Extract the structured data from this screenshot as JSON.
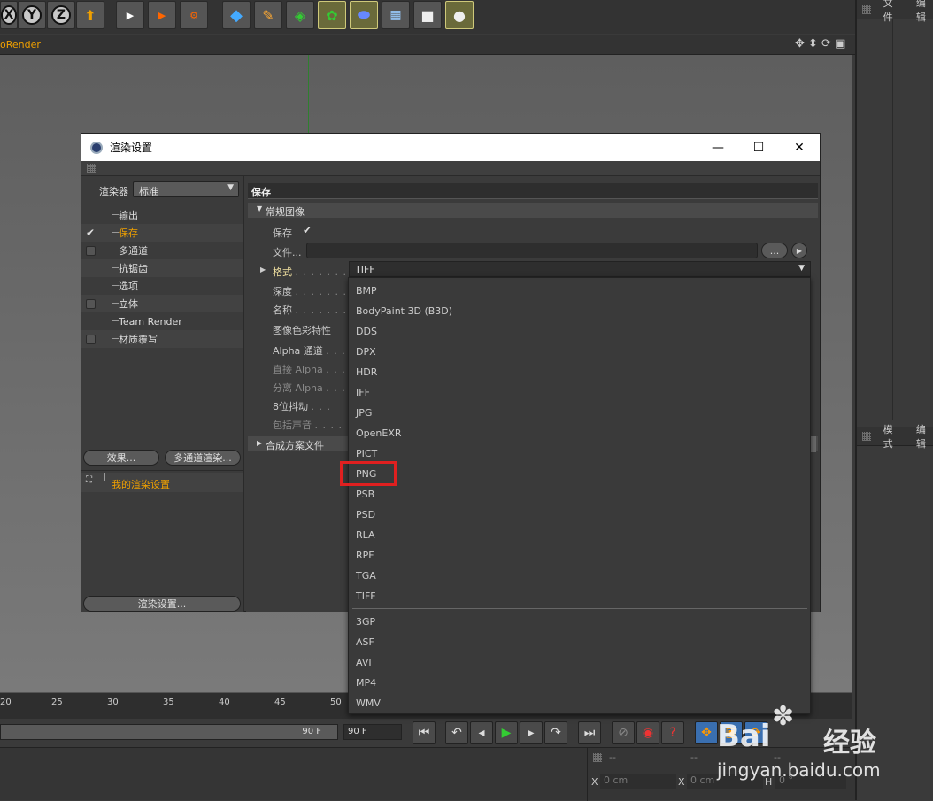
{
  "toolbar": {
    "axes": [
      "X",
      "Y",
      "Z"
    ]
  },
  "viewport": {
    "title": "oRender"
  },
  "right_panel": {
    "tabs_top": [
      "文件",
      "编辑"
    ],
    "tabs_mid": [
      "模式",
      "编辑"
    ]
  },
  "timeline": {
    "ticks": [
      "20",
      "25",
      "30",
      "35",
      "40",
      "45",
      "50"
    ],
    "end_frame": "90 F",
    "end_frame_field": "90 F"
  },
  "coords": {
    "header": [
      "--",
      "--",
      "--"
    ],
    "rows": [
      {
        "l1": "X",
        "v1": "0 cm",
        "l2": "X",
        "v2": "0 cm",
        "l3": "H",
        "v3": "0 °"
      }
    ]
  },
  "dialog": {
    "title": "渲染设置",
    "renderer_label": "渲染器",
    "renderer_value": "标准",
    "nav": [
      {
        "label": "输出",
        "checkbox": false,
        "selected": false
      },
      {
        "label": "保存",
        "checkbox": true,
        "checked": true,
        "selected": true
      },
      {
        "label": "多通道",
        "checkbox": true,
        "checked": false,
        "selected": false
      },
      {
        "label": "抗锯齿",
        "checkbox": false,
        "selected": false
      },
      {
        "label": "选项",
        "checkbox": false,
        "selected": false
      },
      {
        "label": "立体",
        "checkbox": true,
        "checked": false,
        "selected": false
      },
      {
        "label": "Team Render",
        "checkbox": false,
        "selected": false
      },
      {
        "label": "材质覆写",
        "checkbox": true,
        "checked": false,
        "selected": false
      }
    ],
    "effects_button": "效果...",
    "multipass_button": "多通道渲染...",
    "preset_label": "我的渲染设置",
    "render_settings_button": "渲染设置...",
    "section_title": "保存",
    "group_title": "常规图像",
    "save_label": "保存",
    "file_label": "文件...",
    "browse_button": "...",
    "format_label": "格式",
    "format_value": "TIFF",
    "props": [
      {
        "label": "深度",
        "dim": false
      },
      {
        "label": "名称",
        "dim": false
      },
      {
        "label": "图像色彩特性",
        "dim": false
      },
      {
        "label": "Alpha 通道",
        "dim": false
      },
      {
        "label": "直接 Alpha",
        "dim": true
      },
      {
        "label": "分离 Alpha",
        "dim": true
      },
      {
        "label": "8位抖动",
        "dim": false
      },
      {
        "label": "包括声音",
        "dim": true
      }
    ],
    "composition_group": "合成方案文件"
  },
  "format_dropdown": {
    "options_image": [
      "BMP",
      "BodyPaint 3D (B3D)",
      "DDS",
      "DPX",
      "HDR",
      "IFF",
      "JPG",
      "OpenEXR",
      "PICT",
      "PNG",
      "PSB",
      "PSD",
      "RLA",
      "RPF",
      "TGA",
      "TIFF"
    ],
    "options_movie": [
      "3GP",
      "ASF",
      "AVI",
      "MP4",
      "WMV"
    ],
    "highlighted": "PNG",
    "highlight_color": "#e02020"
  },
  "watermark": {
    "text1": "Bai",
    "text2": "经验",
    "url": "jingyan.baidu.com"
  }
}
